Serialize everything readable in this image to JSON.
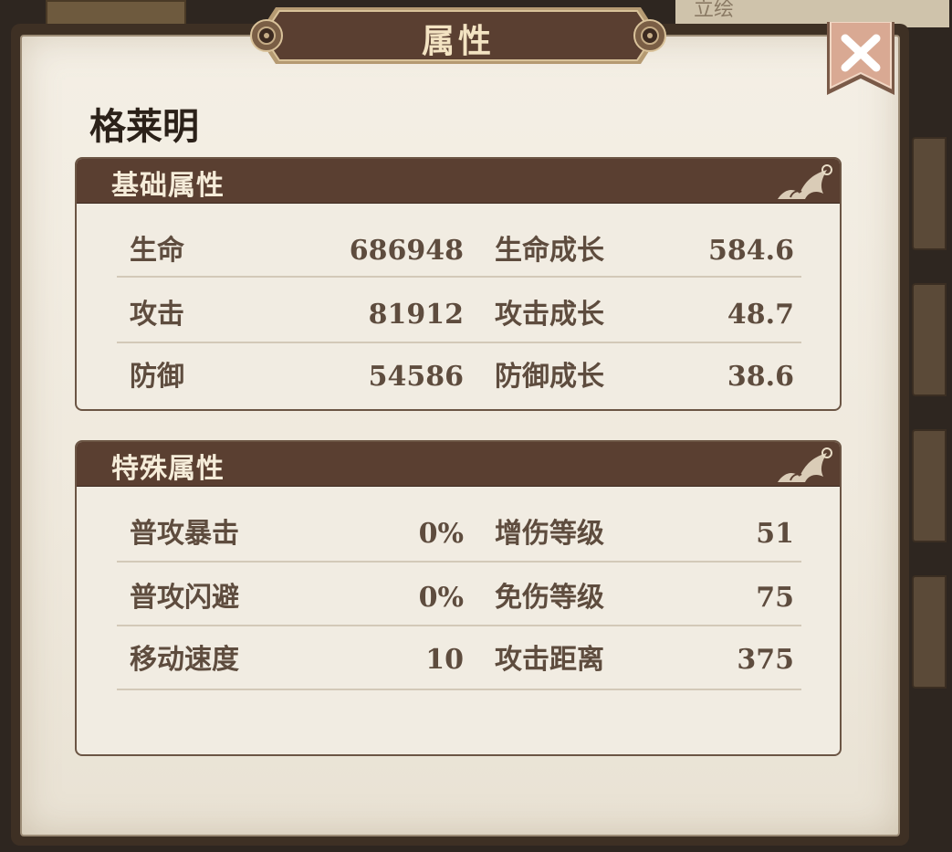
{
  "title": "属性",
  "hero_name": "格莱明",
  "background_tab_text": "立绘",
  "colors": {
    "header_brown": "#5a3f31",
    "paper": "#f1ece2",
    "text": "#5e4c3e",
    "title_text": "#f3e3c2",
    "close_bg": "#d8a88f"
  },
  "basic": {
    "title": "基础属性",
    "rows": [
      {
        "label1": "生命",
        "value1": "686948",
        "label2": "生命成长",
        "value2": "584.6"
      },
      {
        "label1": "攻击",
        "value1": "81912",
        "label2": "攻击成长",
        "value2": "48.7"
      },
      {
        "label1": "防御",
        "value1": "54586",
        "label2": "防御成长",
        "value2": "38.6"
      }
    ]
  },
  "special": {
    "title": "特殊属性",
    "rows": [
      {
        "label1": "普攻暴击",
        "value1": "0%",
        "label2": "增伤等级",
        "value2": "51"
      },
      {
        "label1": "普攻闪避",
        "value1": "0%",
        "label2": "免伤等级",
        "value2": "75"
      },
      {
        "label1": "移动速度",
        "value1": "10",
        "label2": "攻击距离",
        "value2": "375"
      }
    ]
  },
  "icons": {
    "close": "close-icon",
    "ornament": "floral-ornament-icon",
    "rivet": "rivet-icon"
  }
}
